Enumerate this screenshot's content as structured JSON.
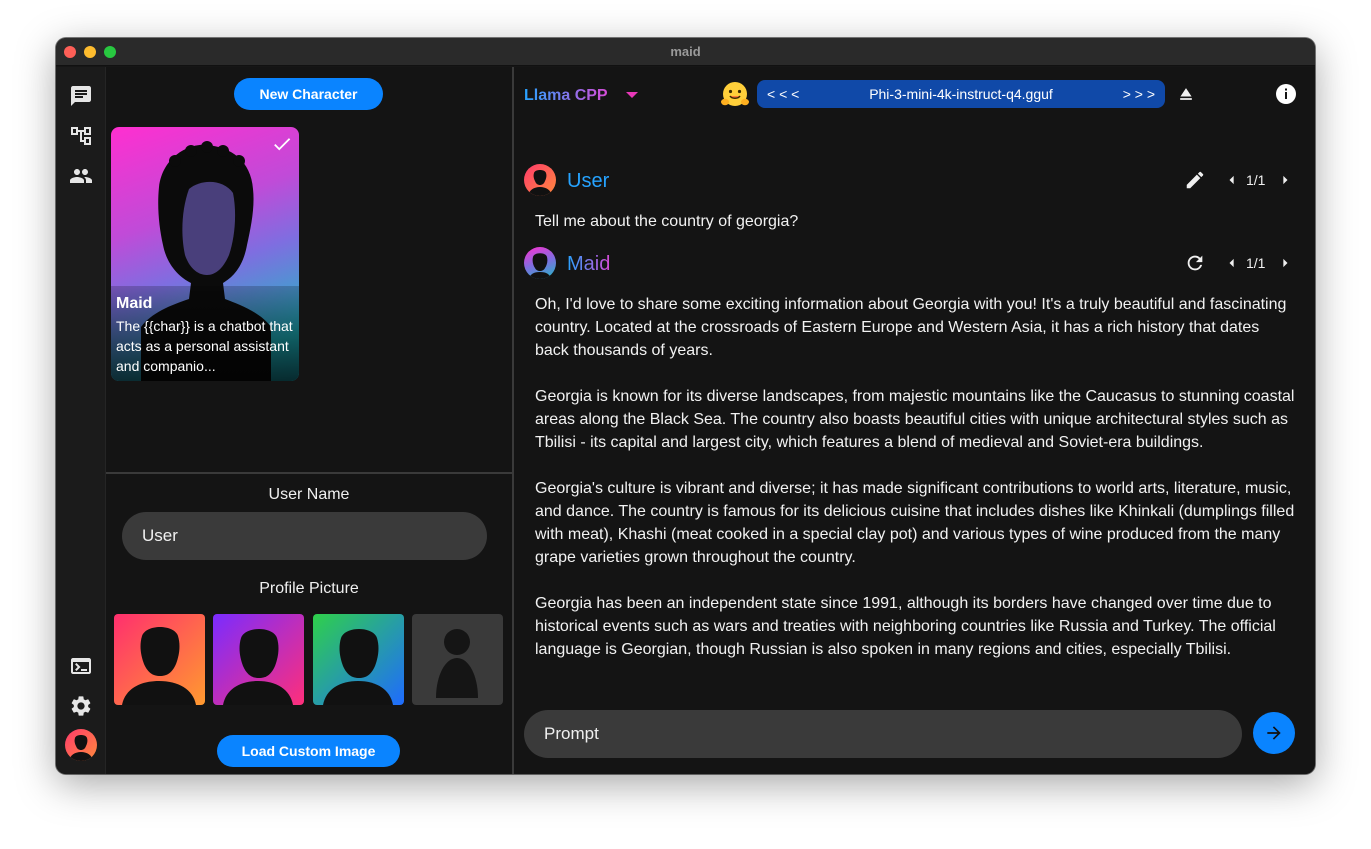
{
  "window": {
    "title": "maid"
  },
  "rail": {
    "icons": [
      "chat-icon",
      "model-tree-icon",
      "people-icon",
      "terminal-icon",
      "gear-icon",
      "user-avatar"
    ]
  },
  "characters": {
    "new_button": "New Character",
    "cards": [
      {
        "name": "Maid",
        "description": "The {{char}} is a chatbot that acts as a personal assistant and companio...",
        "selected": true
      }
    ]
  },
  "user_settings": {
    "user_name_label": "User Name",
    "user_name_value": "User",
    "profile_picture_label": "Profile Picture",
    "load_custom_button": "Load Custom Image"
  },
  "header": {
    "api_type": "Llama CPP",
    "model_prev": "< < <",
    "model_name": "Phi-3-mini-4k-instruct-q4.gguf",
    "model_next": "> > >"
  },
  "messages": [
    {
      "sender": "User",
      "counter": "1/1",
      "text": "Tell me about the country of georgia?"
    },
    {
      "sender": "Maid",
      "counter": "1/1",
      "paragraphs": [
        "Oh, I'd love to share some exciting information about Georgia with you! It's a truly beautiful and fascinating country. Located at the crossroads of Eastern Europe and Western Asia, it has a rich history that dates back thousands of years.",
        "Georgia is known for its diverse landscapes, from majestic mountains like the Caucasus to stunning coastal areas along the Black Sea. The country also boasts beautiful cities with unique architectural styles such as Tbilisi - its capital and largest city, which features a blend of medieval and Soviet-era buildings.",
        "Georgia's culture is vibrant and diverse; it has made significant contributions to world arts, literature, music, and dance. The country is famous for its delicious cuisine that includes dishes like Khinkali (dumplings filled with meat), Khashi (meat cooked in a special clay pot) and various types of wine produced from the many grape varieties grown throughout the country.",
        "Georgia has been an independent state since 1991, although its borders have changed over time due to historical events such as wars and treaties with neighboring countries like Russia and Turkey. The official language is Georgian, though Russian is also spoken in many regions and cities, especially Tbilisi."
      ]
    }
  ],
  "prompt": {
    "placeholder": "Prompt"
  },
  "colors": {
    "accent": "#0a84ff",
    "gradient_start": "#26a3ff",
    "gradient_end": "#d84bd8",
    "background": "#141414"
  }
}
